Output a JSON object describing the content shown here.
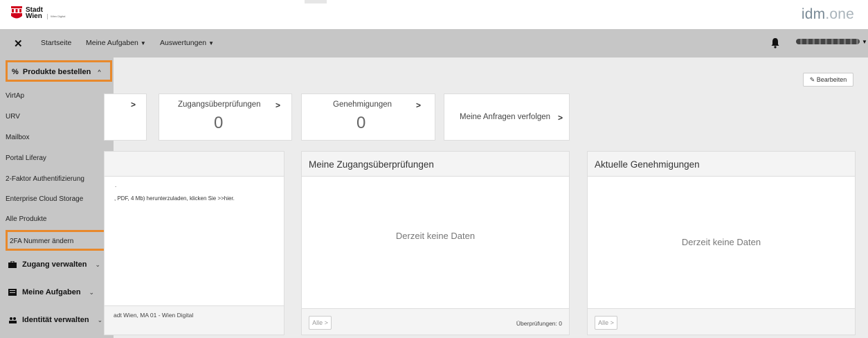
{
  "header": {
    "logo_line1": "Stadt",
    "logo_line2": "Wien",
    "logo_sub": "Wien Digital",
    "brand_main": "idm",
    "brand_dot": ".one"
  },
  "nav": {
    "home": "Startseite",
    "tasks": "Meine Aufgaben",
    "reports": "Auswertungen"
  },
  "sidebar": {
    "order_products": "Produkte bestellen",
    "items": [
      "VirtAp",
      "URV",
      "Mailbox",
      "Portal Liferay",
      "2-Faktor Authentifizierung",
      "Enterprise Cloud Storage",
      "Alle Produkte"
    ],
    "highlight_item": "2FA Nummer ändern",
    "sections": [
      "Zugang verwalten",
      "Meine Aufgaben",
      "Identität verwalten"
    ]
  },
  "edit_label": "Bearbeiten",
  "tiles": {
    "access_reviews_title": "Zugangsüberprüfungen",
    "access_reviews_count": "0",
    "approvals_title": "Genehmigungen",
    "approvals_count": "0",
    "my_requests": "Meine Anfragen verfolgen"
  },
  "panels": {
    "left_body_line": ", PDF, 4 Mb) herunterzuladen, klicken Sie >>hier.",
    "left_footer": "adt Wien, MA 01 - Wien Digital",
    "reviews_title": "Meine Zugangsüberprüfungen",
    "reviews_empty": "Derzeit keine Daten",
    "reviews_footer_count": "Überprüfungen: 0",
    "approvals_title": "Aktuelle Genehmigungen",
    "approvals_empty": "Derzeit keine Daten",
    "alle": "Alle"
  }
}
